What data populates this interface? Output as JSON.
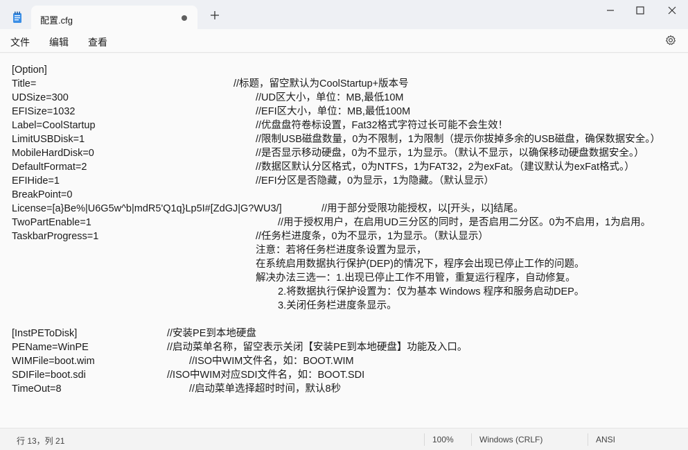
{
  "window": {
    "tab_title": "配置.cfg"
  },
  "menu": {
    "file": "文件",
    "edit": "编辑",
    "view": "查看"
  },
  "icons": {
    "app": "notepad-icon",
    "tab_dot": "unsaved-dot-icon",
    "new_tab": "plus-icon",
    "minimize": "minimize-icon",
    "maximize": "maximize-icon",
    "close": "close-icon",
    "settings": "gear-icon"
  },
  "document": {
    "lines": [
      {
        "key": "[Option]",
        "comment": ""
      },
      {
        "key": "Title=",
        "comment": "//标题，留空默认为CoolStartup+版本号"
      },
      {
        "key": "UDSize=300",
        "comment": "//UD区大小，单位：MB,最低10M"
      },
      {
        "key": "EFISize=1032",
        "comment": "//EFI区大小，单位：MB,最低100M"
      },
      {
        "key": "Label=CoolStartup",
        "comment": "//优盘盘符卷标设置，Fat32格式字符过长可能不会生效！"
      },
      {
        "key": "LimitUSBDisk=1",
        "comment": "//限制USB磁盘数量，0为不限制，1为限制（提示你拔掉多余的USB磁盘，确保数据安全。）"
      },
      {
        "key": "MobileHardDisk=0",
        "comment": "//是否显示移动硬盘，0为不显示，1为显示。（默认不显示，以确保移动硬盘数据安全。）"
      },
      {
        "key": "DefaultFormat=2",
        "comment": "//数据区默认分区格式，0为NTFS，1为FAT32，2为exFat。（建议默认为exFat格式。）"
      },
      {
        "key": "EFIHide=1",
        "comment": "//EFI分区是否隐藏，0为显示，1为隐藏。（默认显示）"
      },
      {
        "key": "BreakPoint=0",
        "comment": ""
      },
      {
        "key": "License=[a}Be%|U6G5w^b|mdR5'Q1q}Lp5I#[ZdGJ|G?WU3/]",
        "comment": "//用于部分受限功能授权，以[开头，以]结尾。"
      },
      {
        "key": "TwoPartEnable=1",
        "comment": "//用于授权用户，在启用UD三分区的同时，是否启用二分区。0为不启用，1为启用。"
      },
      {
        "key": "TaskbarProgress=1",
        "comment": "//任务栏进度条，0为不显示，1为显示。（默认显示）"
      },
      {
        "key": "",
        "comment": "注意：若将任务栏进度条设置为显示，"
      },
      {
        "key": "",
        "comment": "在系统启用数据执行保护(DEP)的情况下，程序会出现已停止工作的问题。"
      },
      {
        "key": "",
        "comment": "解决办法三选一：1.出现已停止工作不用管，重复运行程序，自动修复。"
      },
      {
        "key": "",
        "comment": "2.将数据执行保护设置为：仅为基本 Windows 程序和服务启动DEP。"
      },
      {
        "key": "",
        "comment": "3.关闭任务栏进度条显示。"
      },
      {
        "key": "",
        "comment": ""
      },
      {
        "key": "[InstPEToDisk]",
        "comment": "//安装PE到本地硬盘"
      },
      {
        "key": "PEName=WinPE",
        "comment": "//启动菜单名称，留空表示关闭【安装PE到本地硬盘】功能及入口。"
      },
      {
        "key": "WIMFile=boot.wim",
        "comment": "//ISO中WIM文件名，如：BOOT.WIM"
      },
      {
        "key": "SDIFile=boot.sdi",
        "comment": "//ISO中WIM对应SDI文件名，如：BOOT.SDI"
      },
      {
        "key": "TimeOut=8",
        "comment": "//启动菜单选择超时时间，默认8秒"
      }
    ]
  },
  "status": {
    "position": "行 13，列 21",
    "zoom": "100%",
    "line_ending": "Windows (CRLF)",
    "encoding": "ANSI"
  }
}
